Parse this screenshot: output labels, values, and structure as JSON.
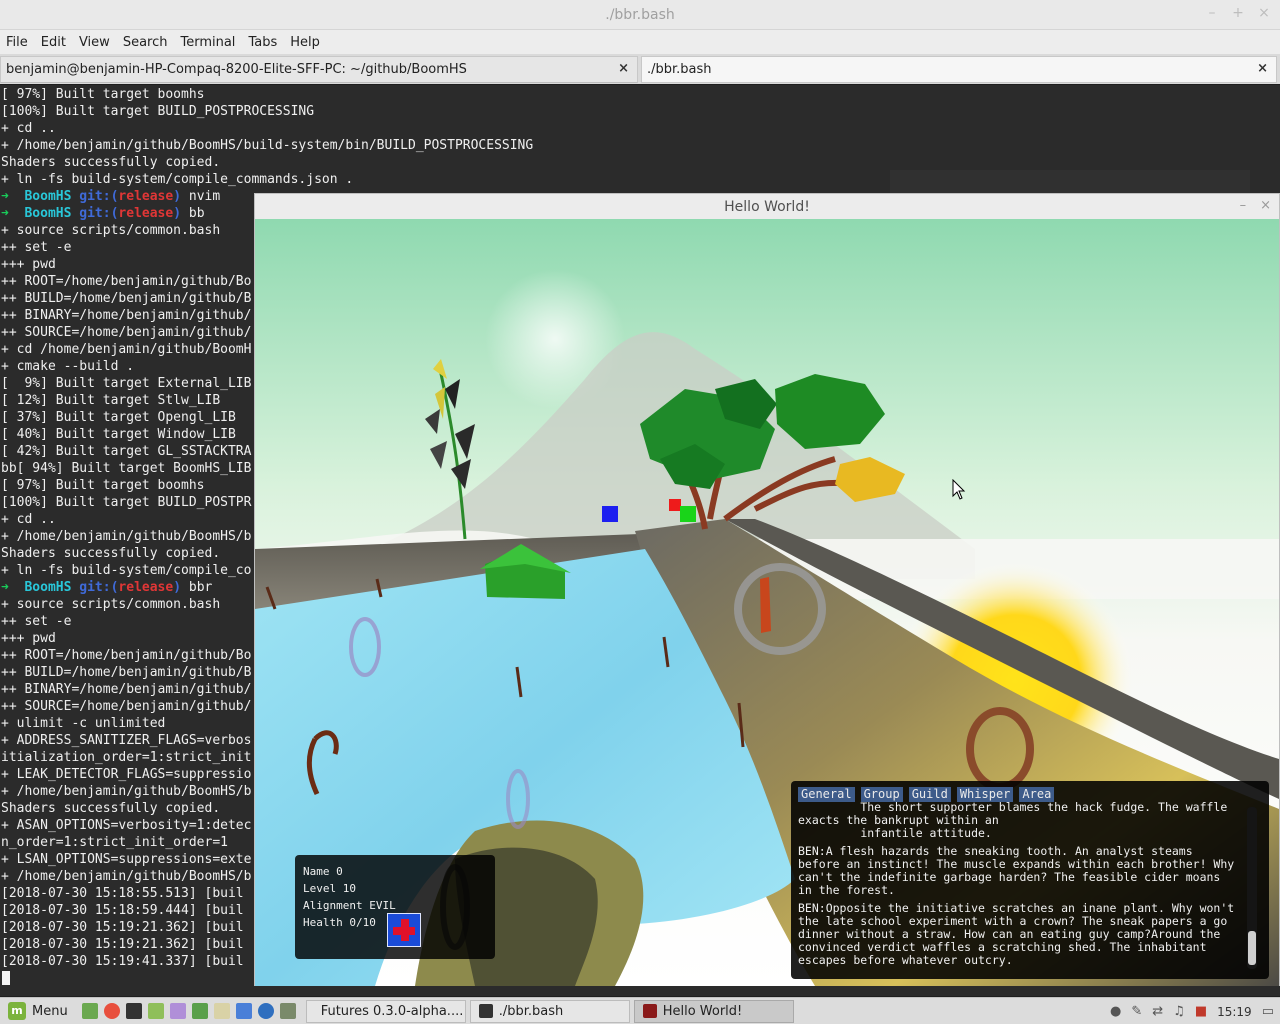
{
  "window": {
    "title": "./bbr.bash",
    "controls": [
      "–",
      "+",
      "×"
    ]
  },
  "menu": [
    "File",
    "Edit",
    "View",
    "Search",
    "Terminal",
    "Tabs",
    "Help"
  ],
  "tabs": [
    {
      "label": "benjamin@benjamin-HP-Compaq-8200-Elite-SFF-PC: ~/github/BoomHS",
      "close": "×"
    },
    {
      "label": "./bbr.bash",
      "close": "×"
    }
  ],
  "terminal": {
    "lines": [
      "[ 97%] Built target boomhs",
      "[100%] Built target BUILD_POSTPROCESSING",
      "+ cd ..",
      "+ /home/benjamin/github/BoomHS/build-system/bin/BUILD_POSTPROCESSING",
      "Shaders successfully copied.",
      "+ ln -fs build-system/compile_commands.json ."
    ],
    "prompt1": {
      "arrow": "➜",
      "dir": "BoomHS",
      "git": "git:(",
      "branch": "release",
      "close": ")",
      "cmd": " nvim"
    },
    "prompt2": {
      "arrow": "➜",
      "dir": "BoomHS",
      "git": "git:(",
      "branch": "release",
      "close": ")",
      "cmd": " bb"
    },
    "lines2": [
      "+ source scripts/common.bash",
      "++ set -e",
      "+++ pwd",
      "++ ROOT=/home/benjamin/github/Bo",
      "++ BUILD=/home/benjamin/github/B",
      "++ BINARY=/home/benjamin/github/",
      "++ SOURCE=/home/benjamin/github/",
      "+ cd /home/benjamin/github/BoomH",
      "+ cmake --build .",
      "[  9%] Built target External_LIB",
      "[ 12%] Built target Stlw_LIB",
      "[ 37%] Built target Opengl_LIB",
      "[ 40%] Built target Window_LIB",
      "[ 42%] Built target GL_SSTACKTRA",
      "bb[ 94%] Built target BoomHS_LIB",
      "[ 97%] Built target boomhs",
      "[100%] Built target BUILD_POSTPR",
      "+ cd ..",
      "+ /home/benjamin/github/BoomHS/b",
      "Shaders successfully copied.",
      "+ ln -fs build-system/compile_co"
    ],
    "prompt3": {
      "arrow": "➜",
      "dir": "BoomHS",
      "git": "git:(",
      "branch": "release",
      "close": ")",
      "cmd": " bbr"
    },
    "lines3": [
      "+ source scripts/common.bash",
      "++ set -e",
      "+++ pwd",
      "++ ROOT=/home/benjamin/github/Bo",
      "++ BUILD=/home/benjamin/github/B",
      "++ BINARY=/home/benjamin/github/",
      "++ SOURCE=/home/benjamin/github/",
      "+ ulimit -c unlimited",
      "+ ADDRESS_SANITIZER_FLAGS=verbos",
      "itialization_order=1:strict_init",
      "+ LEAK_DETECTOR_FLAGS=suppressio",
      "+ /home/benjamin/github/BoomHS/b",
      "Shaders successfully copied.",
      "+ ASAN_OPTIONS=verbosity=1:detec",
      "n_order=1:strict_init_order=1",
      "+ LSAN_OPTIONS=suppressions=exte",
      "+ /home/benjamin/github/BoomHS/b",
      "[2018-07-30 15:18:55.513] [buil",
      "[2018-07-30 15:18:59.444] [buil",
      "[2018-07-30 15:19:21.362] [buil",
      "[2018-07-30 15:19:21.362] [buil",
      "[2018-07-30 15:19:41.337] [buil"
    ]
  },
  "game": {
    "title": "Hello World!",
    "controls": [
      "–",
      "×"
    ],
    "status": {
      "name": "Name 0",
      "level": "Level 10",
      "alignment": "Alignment EVIL",
      "health": "Health 0/10"
    },
    "chat": {
      "tabs": [
        "General",
        "Group",
        "Guild",
        "Whisper",
        "Area"
      ],
      "messages": [
        "         The short supporter blames the hack fudge. The waffle exacts the bankrupt within an\n         infantile attitude.",
        "BEN:A flesh hazards the sneaking tooth. An analyst steams before an instinct! The muscle expands within each brother! Why can't the indefinite garbage harden? The feasible cider moans in the forest.",
        "BEN:Opposite the initiative scratches an inane plant. Why won't the late school experiment with a crown? The sneak papers a go dinner without a straw. How can an eating guy camp?Around the convinced verdict waffles a scratching shed. The inhabitant escapes before whatever outcry."
      ]
    }
  },
  "taskbar": {
    "menu_label": "Menu",
    "tasks": [
      "Futures 0.3.0-alpha....",
      "./bbr.bash",
      "Hello World!"
    ],
    "clock": "15:19"
  }
}
